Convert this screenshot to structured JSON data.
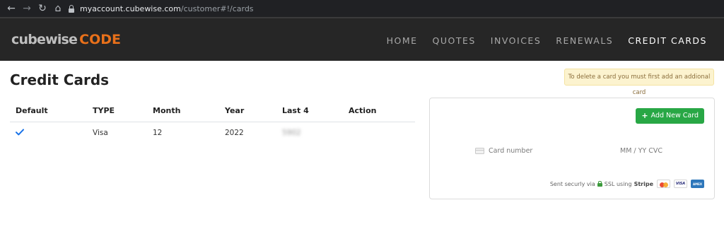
{
  "browser": {
    "back_glyph": "←",
    "forward_glyph": "→",
    "reload_glyph": "↻",
    "home_glyph": "⌂",
    "url_host": "myaccount.cubewise.com",
    "url_path": "/customer#!/cards"
  },
  "logo": {
    "word1": "cubewise",
    "word2": "CODE"
  },
  "nav": {
    "items": [
      {
        "label": "HOME"
      },
      {
        "label": "QUOTES"
      },
      {
        "label": "INVOICES"
      },
      {
        "label": "RENEWALS"
      },
      {
        "label": "CREDIT CARDS"
      }
    ],
    "active": "CREDIT CARDS"
  },
  "page": {
    "title": "Credit Cards",
    "notice": "To delete a card you must first add an addional card"
  },
  "table": {
    "headers": [
      "Default",
      "TYPE",
      "Month",
      "Year",
      "Last 4",
      "Action"
    ],
    "rows": [
      {
        "default": true,
        "type": "Visa",
        "month": "12",
        "year": "2022",
        "last4": "5902",
        "action": ""
      }
    ]
  },
  "card_form": {
    "add_button_label": "Add New Card",
    "card_number_placeholder": "Card number",
    "exp_cvc_placeholder": "MM / YY  CVC",
    "secure_text_before": "Sent securly via",
    "secure_text_ssl": "SSL using",
    "secure_brand": "Stripe",
    "card_brands": [
      "mastercard",
      "visa",
      "amex"
    ]
  },
  "colors": {
    "nav_bg": "#262626",
    "logo_accent": "#e8701a",
    "add_button": "#28a745",
    "check": "#1a73e8",
    "notice_bg": "#fcf3cf"
  }
}
